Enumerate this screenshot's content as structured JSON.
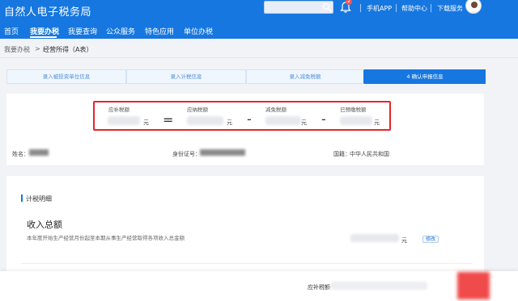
{
  "header": {
    "brand": "自然人电子税务局",
    "links": [
      "手机APP",
      "帮助中心",
      "下载服务"
    ],
    "notification_count": "2"
  },
  "nav": {
    "items": [
      "首页",
      "我要办税",
      "我要查询",
      "公众服务",
      "特色应用",
      "单位办税"
    ],
    "active": "我要办税"
  },
  "breadcrumb": {
    "root": "我要办税",
    "separator": ">",
    "current": "经营所得（A表）"
  },
  "steps": [
    {
      "label": "录入被投资单位信息",
      "state": "done"
    },
    {
      "label": "录入计税信息",
      "state": "done"
    },
    {
      "label": "录入减免税额",
      "state": "done"
    },
    {
      "label": "4   确认申报信息",
      "state": "active"
    }
  ],
  "summary": {
    "items": [
      {
        "label": "应补税额",
        "unit": "元"
      },
      {
        "label": "应纳税额",
        "unit": "元"
      },
      {
        "label": "减免税额",
        "unit": "元"
      },
      {
        "label": "已预缴税额",
        "unit": "元"
      }
    ],
    "operators": [
      "=",
      "-",
      "-"
    ]
  },
  "taxpayer": {
    "name_label": "姓名：",
    "id_label": "身份证号：",
    "country_label": "国籍：",
    "country_value": "中华人民共和国"
  },
  "detail": {
    "section_title": "计税明细",
    "income_title": "收入总额",
    "income_desc": "本年度开始生产经营月份起至本期从事生产经营取得各项收入总金额",
    "income_unit": "元",
    "edit_label": "修改"
  },
  "footer": {
    "label": "应补税额"
  },
  "colors": {
    "primary": "#1677e0",
    "highlight_border": "#e8242b",
    "submit": "#f04a4a"
  }
}
